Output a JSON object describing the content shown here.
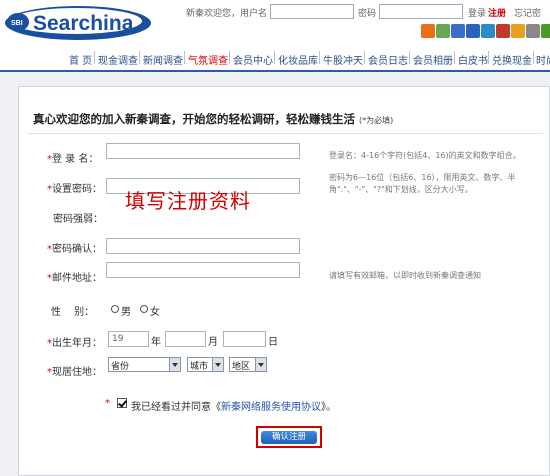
{
  "brand": {
    "logo_badge": "SBI",
    "logo_text": "Searchina"
  },
  "top_login": {
    "welcome": "新秦欢迎您，用户名",
    "password_label": "密码",
    "login_link": "登录",
    "register_link": "注册",
    "forgot_link": "忘记密"
  },
  "top_icons": [
    {
      "name": "rss",
      "color": "#e8701a"
    },
    {
      "name": "globe",
      "color": "#6aa84f"
    },
    {
      "name": "info",
      "color": "#3a6fc4"
    },
    {
      "name": "search",
      "color": "#2b63b8"
    },
    {
      "name": "feed",
      "color": "#2b8ccc"
    },
    {
      "name": "bookmark",
      "color": "#c0392b"
    },
    {
      "name": "lock",
      "color": "#e2a321"
    },
    {
      "name": "users",
      "color": "#888888"
    },
    {
      "name": "check",
      "color": "#4a9a2a"
    }
  ],
  "nav": {
    "items": [
      "首 页",
      "现金调查",
      "新闻调查",
      "气氛调查",
      "会员中心",
      "化妆品库",
      "牛股冲天",
      "会员日志",
      "会员相册",
      "白皮书",
      "兑换现金",
      "时尚"
    ],
    "active_color": "#d40000",
    "active_index": 3
  },
  "intro": {
    "text": "真心欢迎您的加入新秦调查，开始您的轻松调研，轻松赚钱生活",
    "required_note": "(*为必填)"
  },
  "form": {
    "username_label": "登 录 名：",
    "password_label": "设置密码：",
    "strength_label": "密码强弱：",
    "confirm_label": "密码确认：",
    "email_label": "邮件地址：",
    "gender_label": "性　 别：",
    "gender_male": "男",
    "gender_female": "女",
    "birth_label": "出生年月：",
    "birth_year_value": "19",
    "birth_year_unit": "年",
    "birth_month_unit": "月",
    "birth_day_unit": "日",
    "residence_label": "现居住地：",
    "province": "省份",
    "city": "城市",
    "district": "地区"
  },
  "hints": {
    "username": "登录名：4-16个字符(包括4、16)的英文和数字组合。",
    "password_line1": "密码为6—16位（包括6、16），限用英文、数字、半",
    "password_line2": "角\".\"、\"-\"、\"?\"和下划线，区分大小写。",
    "email": "请填写有效邮箱，以即时收到新秦调查通知"
  },
  "overlay_text": "填写注册资料",
  "agreement": {
    "prefix": "我已经看过并同意《",
    "link": "新秦网络服务使用协议",
    "suffix": "》。"
  },
  "submit_label": "确认注册",
  "colors": {
    "brand_blue": "#1a4e9e",
    "nav_border": "#2a5ca8",
    "accent_red": "#d40000",
    "link_blue": "#1f56b0"
  }
}
